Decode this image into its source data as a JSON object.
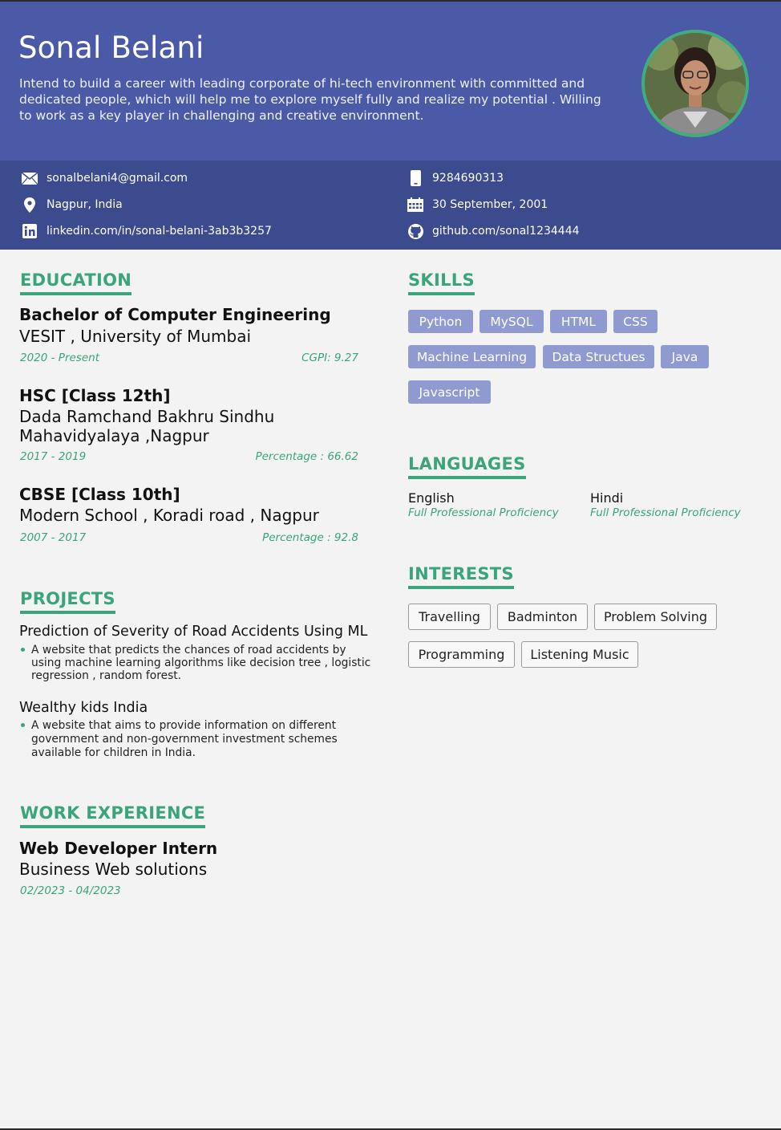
{
  "header": {
    "name": "Sonal Belani",
    "summary": "Intend to build a career with leading corporate of hi-tech environment with committed and dedicated people, which will help me to explore myself fully and realize my potential . Willing to work as a key player in challenging and creative environment."
  },
  "contact": {
    "email": "sonalbelani4@gmail.com",
    "location": "Nagpur, India",
    "linkedin": "linkedin.com/in/sonal-belani-3ab3b3257",
    "phone": "9284690313",
    "dob": "30 September, 2001",
    "github": "github.com/sonal1234444"
  },
  "education": {
    "title": "EDUCATION",
    "items": [
      {
        "degree": "Bachelor of Computer Engineering",
        "institution": "VESIT , University of Mumbai",
        "years": "2020 - Present",
        "score": "CGPI: 9.27"
      },
      {
        "degree": "HSC [Class 12th]",
        "institution_line1": "Dada Ramchand Bakhru Sindhu",
        "institution_line2": "Mahavidyalaya ,Nagpur",
        "years": "2017 - 2019",
        "score": "Percentage : 66.62"
      },
      {
        "degree": "CBSE [Class 10th]",
        "institution": "Modern School , Koradi road , Nagpur",
        "years": "2007 - 2017",
        "score": "Percentage : 92.8"
      }
    ]
  },
  "projects": {
    "title": "PROJECTS",
    "items": [
      {
        "name": "Prediction of Severity of Road Accidents Using ML",
        "desc1": "A website that predicts the chances of road accidents by",
        "desc2": "using machine learning algorithms like decision tree , logistic",
        "desc3": "regression , random forest."
      },
      {
        "name": "Wealthy kids India",
        "desc1": "A website that aims to provide information on different",
        "desc2": "government and non-government investment schemes",
        "desc3": "available for children in India."
      }
    ]
  },
  "work": {
    "title": "WORK EXPERIENCE",
    "role": "Web Developer Intern",
    "company": "Business Web solutions",
    "dates": "02/2023 - 04/2023"
  },
  "skills": {
    "title": "SKILLS",
    "items": [
      "Python",
      "MySQL",
      "HTML",
      "CSS",
      "Machine Learning",
      "Data Structues",
      "Java",
      "Javascript"
    ]
  },
  "languages": {
    "title": "LANGUAGES",
    "items": [
      {
        "name": "English",
        "level": "Full Professional Proficiency"
      },
      {
        "name": "Hindi",
        "level": "Full Professional Proficiency"
      }
    ]
  },
  "interests": {
    "title": "INTERESTS",
    "items": [
      "Travelling",
      "Badminton",
      "Problem Solving",
      "Programming",
      "Listening Music"
    ]
  },
  "colors": {
    "header": "#4a5aa7",
    "contact_bar": "#3c4a8e",
    "accent": "#3aa57a",
    "skill_tag": "#8f9ad0"
  },
  "icons": [
    "envelope-icon",
    "map-pin-icon",
    "linkedin-icon",
    "phone-icon",
    "calendar-icon",
    "github-icon"
  ]
}
